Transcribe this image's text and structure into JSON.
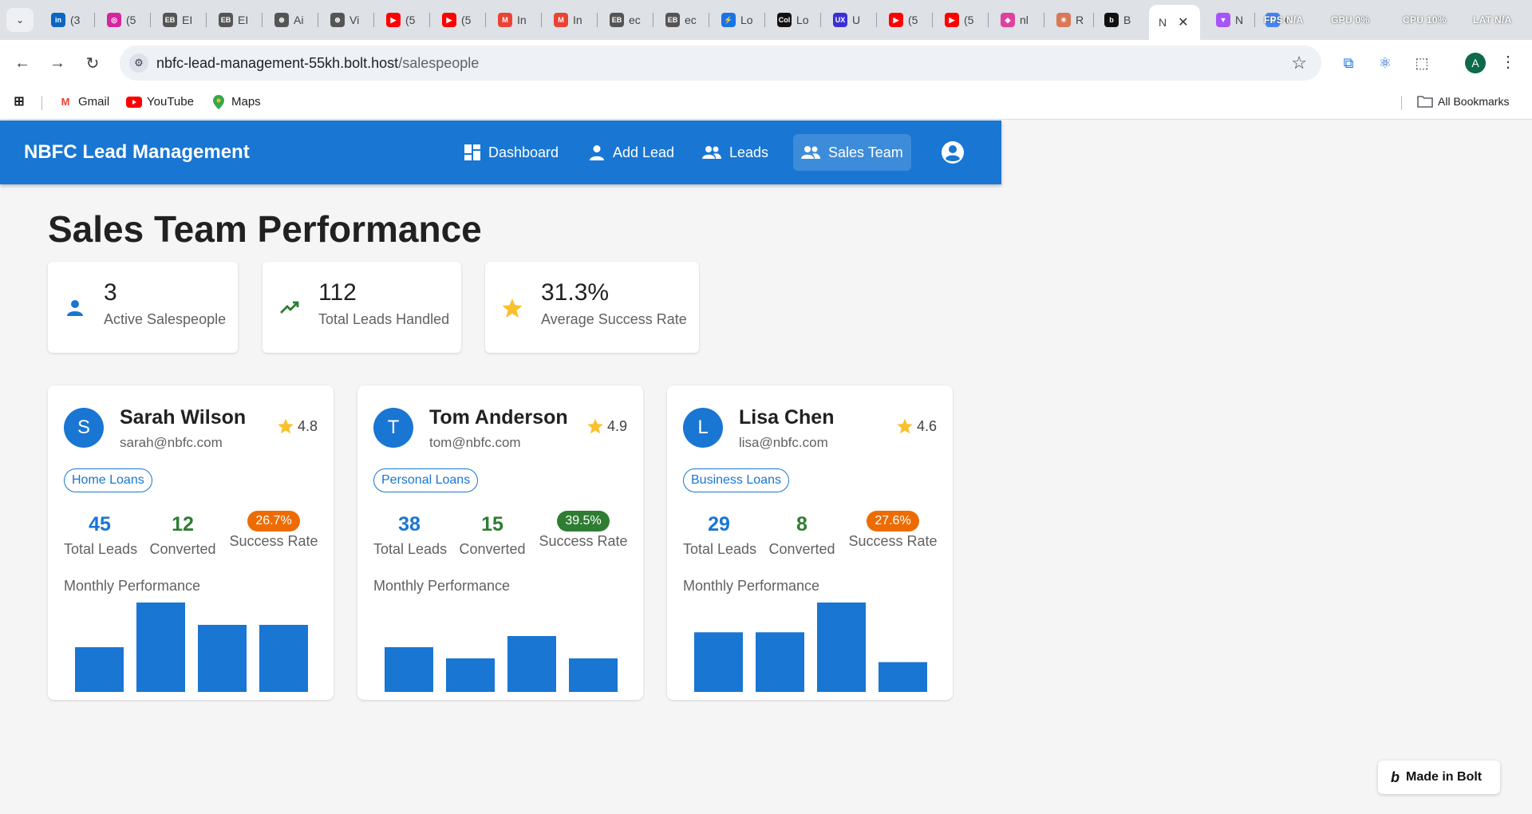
{
  "browser": {
    "tabs": [
      {
        "label": "(3",
        "fav_text": "in",
        "fav_color": "#0a66c2"
      },
      {
        "label": "(5",
        "fav_text": "◎",
        "fav_color": "#d6249f"
      },
      {
        "label": "EI",
        "fav_text": "EB",
        "fav_color": "#555555"
      },
      {
        "label": "EI",
        "fav_text": "EB",
        "fav_color": "#555555"
      },
      {
        "label": "Ai",
        "fav_text": "⊛",
        "fav_color": "#555555"
      },
      {
        "label": "Vi",
        "fav_text": "⊛",
        "fav_color": "#555555"
      },
      {
        "label": "(5",
        "fav_text": "▶",
        "fav_color": "#ff0000"
      },
      {
        "label": "(5",
        "fav_text": "▶",
        "fav_color": "#ff0000"
      },
      {
        "label": "In",
        "fav_text": "M",
        "fav_color": "#ea4335"
      },
      {
        "label": "In",
        "fav_text": "M",
        "fav_color": "#ea4335"
      },
      {
        "label": "ec",
        "fav_text": "EB",
        "fav_color": "#555555"
      },
      {
        "label": "ec",
        "fav_text": "EB",
        "fav_color": "#555555"
      },
      {
        "label": "Lo",
        "fav_text": "⚡",
        "fav_color": "#1a73e8"
      },
      {
        "label": "Lo",
        "fav_text": "Col",
        "fav_color": "#111111"
      },
      {
        "label": "U",
        "fav_text": "UX",
        "fav_color": "#3b2fd3"
      },
      {
        "label": "(5",
        "fav_text": "▶",
        "fav_color": "#ff0000"
      },
      {
        "label": "(5",
        "fav_text": "▶",
        "fav_color": "#ff0000"
      },
      {
        "label": "nl",
        "fav_text": "◆",
        "fav_color": "#e040a0"
      },
      {
        "label": "R",
        "fav_text": "✳",
        "fav_color": "#d97757"
      },
      {
        "label": "B",
        "fav_text": "b",
        "fav_color": "#111111"
      },
      {
        "label": "N",
        "fav_text": "",
        "fav_color": "#ffffff"
      },
      {
        "label": "N",
        "fav_text": "▼",
        "fav_color": "#a855f7"
      },
      {
        "label": "G",
        "fav_text": "G",
        "fav_color": "#4285f4"
      }
    ],
    "perf": {
      "fps_label": "FPS",
      "fps_value": "N/A",
      "gpu_label": "GPU",
      "gpu_value": "0%",
      "cpu_label": "CPU",
      "cpu_value": "10%",
      "lat_label": "LAT",
      "lat_value": "N/A"
    },
    "url_host": "nbfc-lead-management-55kh.bolt.host",
    "url_path": "/salespeople",
    "profile_initial": "A",
    "bookmarks": [
      {
        "label": "Gmail",
        "icon": "gmail-icon"
      },
      {
        "label": "YouTube",
        "icon": "youtube-icon"
      },
      {
        "label": "Maps",
        "icon": "maps-icon"
      }
    ],
    "all_bookmarks": "All Bookmarks"
  },
  "app": {
    "title": "NBFC Lead Management",
    "nav": [
      {
        "label": "Dashboard",
        "icon": "dashboard-icon"
      },
      {
        "label": "Add Lead",
        "icon": "person-icon"
      },
      {
        "label": "Leads",
        "icon": "people-icon"
      },
      {
        "label": "Sales Team",
        "icon": "people-icon",
        "active": true
      }
    ],
    "page_title": "Sales Team Performance",
    "stats": [
      {
        "value": "3",
        "label": "Active Salespeople",
        "icon": "person-icon",
        "color": "#1976d2"
      },
      {
        "value": "112",
        "label": "Total Leads Handled",
        "icon": "trending-up-icon",
        "color": "#2e7d32"
      },
      {
        "value": "31.3%",
        "label": "Average Success Rate",
        "icon": "star-icon",
        "color": "#fbc02d"
      }
    ],
    "salespeople": [
      {
        "initial": "S",
        "name": "Sarah Wilson",
        "email": "sarah@nbfc.com",
        "rating": "4.8",
        "specialty": "Home Loans",
        "total_leads": "45",
        "total_leads_label": "Total Leads",
        "converted": "12",
        "converted_label": "Converted",
        "success_rate": "26.7%",
        "success_rate_label": "Success Rate",
        "rate_color": "#ed6c02",
        "monthly_label": "Monthly Performance",
        "monthly": [
          0.5,
          1.0,
          0.75,
          0.75
        ]
      },
      {
        "initial": "T",
        "name": "Tom Anderson",
        "email": "tom@nbfc.com",
        "rating": "4.9",
        "specialty": "Personal Loans",
        "total_leads": "38",
        "total_leads_label": "Total Leads",
        "converted": "15",
        "converted_label": "Converted",
        "success_rate": "39.5%",
        "success_rate_label": "Success Rate",
        "rate_color": "#2e7d32",
        "monthly_label": "Monthly Performance",
        "monthly": [
          0.5,
          0.375,
          0.625,
          0.375
        ]
      },
      {
        "initial": "L",
        "name": "Lisa Chen",
        "email": "lisa@nbfc.com",
        "rating": "4.6",
        "specialty": "Business Loans",
        "total_leads": "29",
        "total_leads_label": "Total Leads",
        "converted": "8",
        "converted_label": "Converted",
        "success_rate": "27.6%",
        "success_rate_label": "Success Rate",
        "rate_color": "#ed6c02",
        "monthly_label": "Monthly Performance",
        "monthly": [
          0.667,
          0.667,
          1.0,
          0.333
        ]
      }
    ],
    "colors": {
      "primary": "#1976d2",
      "converted": "#2e7d32",
      "star": "#fbc02d",
      "bar": "#1976d2"
    },
    "badge": "Made in Bolt"
  }
}
